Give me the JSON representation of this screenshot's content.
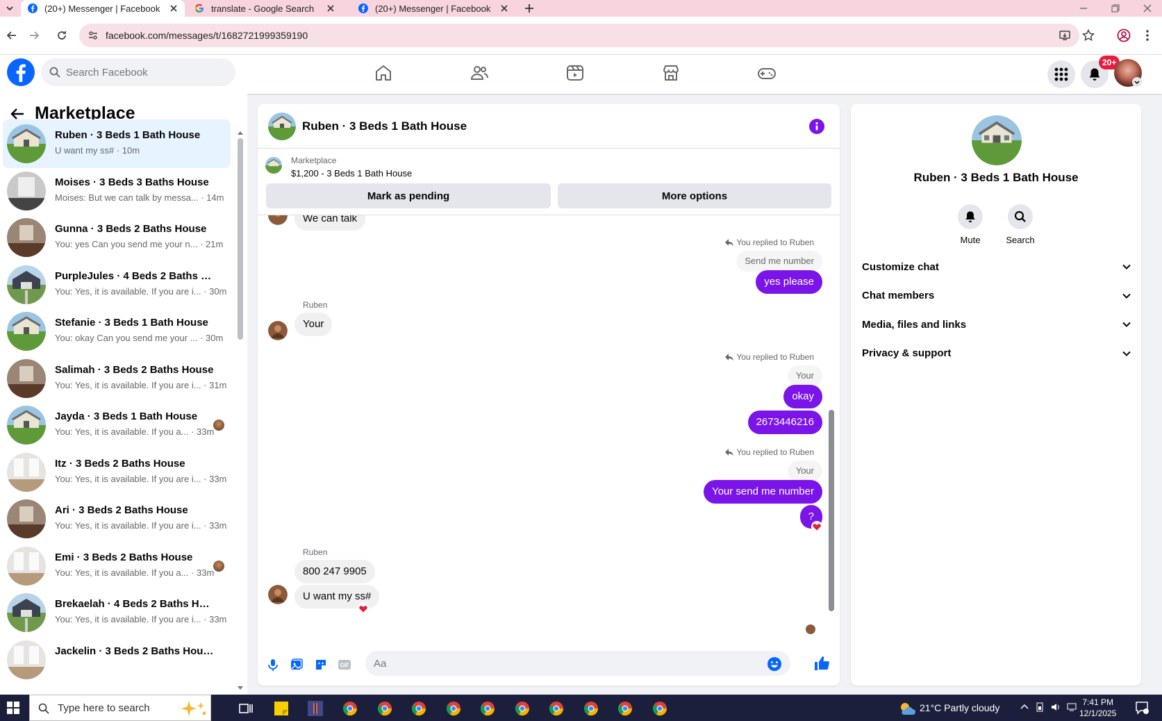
{
  "browser": {
    "tabs": [
      {
        "title": "(20+) Messenger | Facebook",
        "active": true,
        "favicon": "facebook-icon"
      },
      {
        "title": "translate - Google Search",
        "active": false,
        "favicon": "google-icon"
      },
      {
        "title": "(20+) Messenger | Facebook",
        "active": false,
        "favicon": "facebook-icon"
      }
    ],
    "url": "facebook.com/messages/t/1682721999359190"
  },
  "fb_header": {
    "search_placeholder": "Search Facebook",
    "notification_badge": "20+"
  },
  "sidebar": {
    "title": "Marketplace",
    "conversations": [
      {
        "name": "Ruben · 3 Beds 1 Bath House",
        "preview": "U want my ss# · 10m",
        "thumb": "green-house",
        "selected": true
      },
      {
        "name": "Moises · 3 Beds 3 Baths House",
        "preview": "Moises: But we can talk by messa... · 14m",
        "thumb": "gray-interior"
      },
      {
        "name": "Gunna · 3 Beds 2 Baths House",
        "preview": "You: yes Can you send me your n... · 21m",
        "thumb": "brown-interior"
      },
      {
        "name": "PurpleJules · 4 Beds 2 Baths Ho...",
        "preview": "You: Yes, it is available. If you are i... · 30m",
        "thumb": "dark-house"
      },
      {
        "name": "Stefanie · 3 Beds 1 Bath House",
        "preview": "You: okay Can you send me your ... · 30m",
        "thumb": "green-house"
      },
      {
        "name": "Salimah · 3 Beds 2 Baths House",
        "preview": "You: Yes, it is available. If you are i... · 31m",
        "thumb": "brown-interior"
      },
      {
        "name": "Jayda · 3 Beds 1 Bath House",
        "preview": "You: Yes, it is available. If you a... · 33m",
        "thumb": "green-house",
        "mini": true
      },
      {
        "name": "Itz · 3 Beds 2 Baths House",
        "preview": "You: Yes, it is available. If you are i... · 33m",
        "thumb": "white-interior"
      },
      {
        "name": "Ari · 3 Beds 2 Baths House",
        "preview": "You: Yes, it is available. If you are i... · 33m",
        "thumb": "brown-interior"
      },
      {
        "name": "Emi · 3 Beds 2 Baths House",
        "preview": "You: Yes, it is available. If you a... · 33m",
        "thumb": "white-interior",
        "mini": true
      },
      {
        "name": "Brekaelah · 4 Beds 2 Baths House",
        "preview": "You: Yes, it is available. If you are i... · 33m",
        "thumb": "dark-house"
      },
      {
        "name": "Jackelin · 3 Beds 2 Baths House",
        "preview": "",
        "thumb": "white-interior"
      }
    ]
  },
  "chat": {
    "title": "Ruben · 3 Beds 1 Bath House",
    "listing_source": "Marketplace",
    "listing_price": "$1,200 - 3 Beds 1 Bath House",
    "mark_pending_label": "Mark as pending",
    "more_options_label": "More options",
    "top_partial": "We can talk",
    "reply_note": "You replied to Ruben",
    "quote_send_number": "Send me number",
    "msg_yes_please": "yes please",
    "sender_name": "Ruben",
    "msg_your": "Your",
    "quote_your": "Your",
    "msg_okay": "okay",
    "msg_number": "2673446216",
    "msg_your_send": "Your send me number",
    "msg_question": "?",
    "msg_800": "800 247 9905",
    "msg_ssn": "U want my ss#",
    "input_placeholder": "Aa"
  },
  "right_panel": {
    "name": "Ruben · 3 Beds 1 Bath House",
    "mute_label": "Mute",
    "search_label": "Search",
    "sections": [
      "Customize chat",
      "Chat members",
      "Media, files and links",
      "Privacy & support"
    ]
  },
  "taskbar": {
    "search_placeholder": "Type here to search",
    "weather": "21°C  Partly cloudy",
    "time": "7:41 PM",
    "date": "12/1/2025"
  },
  "colors": {
    "fb_blue": "#0866ff",
    "messenger_purple": "#7a14e8",
    "selected_bg": "#e7f3ff",
    "tabbar": "#f7d4de"
  }
}
